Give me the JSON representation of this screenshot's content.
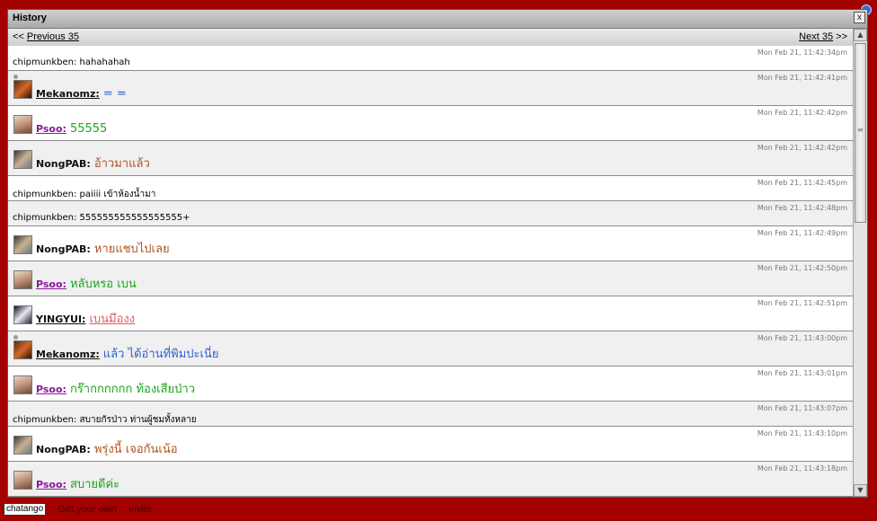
{
  "window": {
    "title": "History",
    "close_label": "x"
  },
  "nav": {
    "prev_prefix": "<<",
    "prev_label": "Previous 35",
    "next_label": "Next 35",
    "next_suffix": ">>"
  },
  "scrollbar": {
    "up_glyph": "▲",
    "down_glyph": "▼",
    "grip": "≡"
  },
  "messages": [
    {
      "kind": "plain",
      "text": "chipmunkben: hahahahah",
      "time": "Mon Feb 21, 11:42:34pm"
    },
    {
      "kind": "user",
      "user": "Mekanomz:",
      "text": "= =",
      "time": "Mon Feb 21, 11:42:41pm",
      "style": "mek"
    },
    {
      "kind": "user",
      "user": "Psoo:",
      "text": "55555",
      "time": "Mon Feb 21, 11:42:42pm",
      "style": "psoo"
    },
    {
      "kind": "user",
      "user": "NongPAB:",
      "text": "อ้าวมาแล้ว",
      "time": "Mon Feb 21, 11:42:42pm",
      "style": "nong"
    },
    {
      "kind": "plain",
      "text": "chipmunkben: paiiii เข้าห้องน้ำมา",
      "time": "Mon Feb 21, 11:42:45pm"
    },
    {
      "kind": "plain",
      "text": "chipmunkben: 555555555555555555+",
      "time": "Mon Feb 21, 11:42:48pm"
    },
    {
      "kind": "user",
      "user": "NongPAB:",
      "text": "หายแชบไปเลย",
      "time": "Mon Feb 21, 11:42:49pm",
      "style": "nong"
    },
    {
      "kind": "user",
      "user": "Psoo:",
      "text": "หลับหรอ เบน",
      "time": "Mon Feb 21, 11:42:50pm",
      "style": "psoo"
    },
    {
      "kind": "user",
      "user": "YINGYUI:",
      "text": "เบนมึองง",
      "time": "Mon Feb 21, 11:42:51pm",
      "style": "ying"
    },
    {
      "kind": "user",
      "user": "Mekanomz:",
      "text": "แล้ว ได้อ่านที่พิมปะเนี่ย",
      "time": "Mon Feb 21, 11:43:00pm",
      "style": "mek"
    },
    {
      "kind": "user",
      "user": "Psoo:",
      "text": "กร๊ากกกกกก ท้องเสียป่าว",
      "time": "Mon Feb 21, 11:43:01pm",
      "style": "psoo"
    },
    {
      "kind": "plain",
      "text": "chipmunkben: สบายกัรป่าว ท่านผู้ชมทั้งหลาย",
      "time": "Mon Feb 21, 11:43:07pm"
    },
    {
      "kind": "user",
      "user": "NongPAB:",
      "text": "พรุ่งนี้ เจอกันเน้อ",
      "time": "Mon Feb 21, 11:43:10pm",
      "style": "nong"
    },
    {
      "kind": "user",
      "user": "Psoo:",
      "text": "สบายดีค่ะ",
      "time": "Mon Feb 21, 11:43:18pm",
      "style": "psoo"
    }
  ],
  "footer": {
    "brand": "chatango",
    "get_own": "Get your own",
    "invite": "Invite"
  }
}
